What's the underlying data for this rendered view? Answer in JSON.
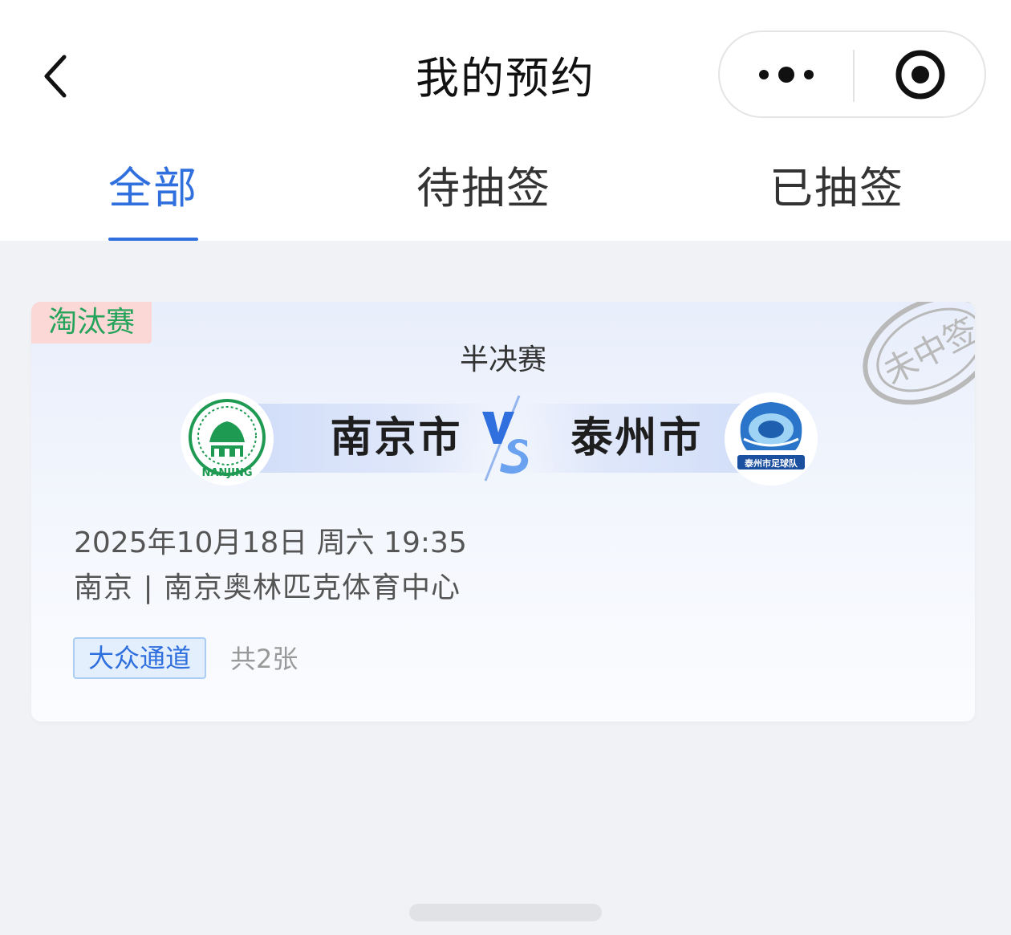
{
  "header": {
    "title": "我的预约",
    "back_icon": "chevron-left-icon",
    "more_icon": "more-dots-icon",
    "close_icon": "target-close-icon"
  },
  "tabs": [
    {
      "label": "全部",
      "active": true
    },
    {
      "label": "待抽签",
      "active": false
    },
    {
      "label": "已抽签",
      "active": false
    }
  ],
  "colors": {
    "accent": "#2f6fde",
    "knockout_tag_bg": "#fbd7d5",
    "knockout_tag_text": "#24a35a",
    "stamp_gray": "#b9b9b9"
  },
  "reservation": {
    "tag": "淘汰赛",
    "stage": "半决赛",
    "home_team": {
      "name": "南京市",
      "logo_text": "NANJING"
    },
    "away_team": {
      "name": "泰州市",
      "logo_text": "泰州市足球队"
    },
    "vs_label": "VS",
    "stamp": "未中签",
    "datetime": "2025年10月18日 周六 19:35",
    "venue": "南京 | 南京奥林匹克体育中心",
    "channel": "大众通道",
    "ticket_count": "共2张"
  }
}
